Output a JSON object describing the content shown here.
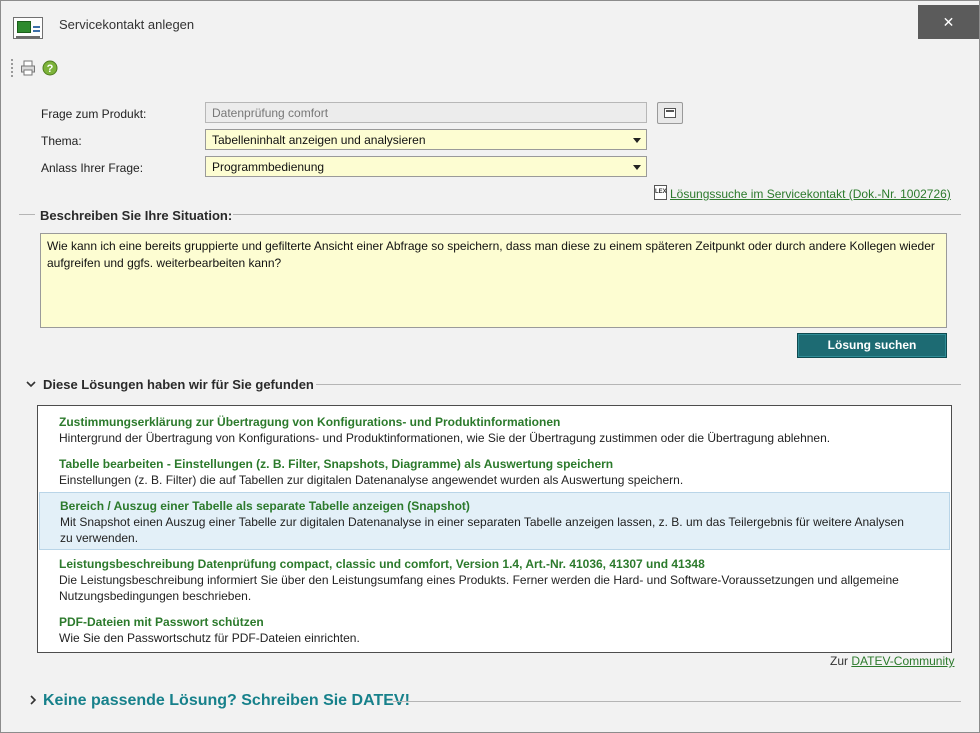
{
  "window": {
    "title": "Servicekontakt anlegen",
    "close_glyph": "✕"
  },
  "toolbar": {
    "icons": [
      "print-icon",
      "help-icon"
    ]
  },
  "form": {
    "product_label": "Frage zum Produkt:",
    "product_value": "Datenprüfung comfort",
    "topic_label": "Thema:",
    "topic_value": "Tabelleninhalt anzeigen und analysieren",
    "reason_label": "Anlass Ihrer Frage:",
    "reason_value": "Programmbedienung",
    "reference_link": "Lösungssuche im Servicekontakt (Dok.-Nr. 1002726)",
    "reference_icon_text": "LEX"
  },
  "situation": {
    "heading": "Beschreiben Sie Ihre Situation:",
    "text": "Wie kann ich eine bereits gruppierte und gefilterte Ansicht einer Abfrage so speichern, dass man diese zu einem späteren Zeitpunkt oder durch andere Kollegen wieder aufgreifen und ggfs. weiterbearbeiten kann?",
    "search_button": "Lösung suchen"
  },
  "solutions": {
    "heading": "Diese Lösungen haben wir für Sie gefunden",
    "items": [
      {
        "title": "Zustimmungserklärung zur Übertragung von Konfigurations- und Produktinformationen",
        "desc": "Hintergrund der Übertragung von Konfigurations- und Produktinformationen, wie Sie der Übertragung zustimmen oder die Übertragung ablehnen."
      },
      {
        "title": "Tabelle bearbeiten - Einstellungen (z. B. Filter, Snapshots, Diagramme) als Auswertung speichern",
        "desc": "Einstellungen (z. B. Filter) die auf Tabellen zur digitalen Datenanalyse angewendet wurden als Auswertung speichern."
      },
      {
        "title": "Bereich / Auszug einer Tabelle als separate Tabelle anzeigen (Snapshot)",
        "desc": "Mit Snapshot einen Auszug einer Tabelle zur digitalen Datenanalyse in einer separaten Tabelle anzeigen lassen, z. B. um das Teilergebnis für weitere Analysen zu verwenden."
      },
      {
        "title": "Leistungsbeschreibung Datenprüfung compact, classic und comfort, Version 1.4, Art.-Nr. 41036, 41307 und 41348",
        "desc": "Die Leistungsbeschreibung informiert Sie über den Leistungsumfang eines Produkts. Ferner werden die Hard- und Software-Voraussetzungen und allgemeine Nutzungsbedingungen beschrieben."
      },
      {
        "title": "PDF-Dateien mit Passwort schützen",
        "desc": "Wie Sie den Passwortschutz für PDF-Dateien einrichten."
      }
    ],
    "community_prefix": "Zur",
    "community_link": "DATEV-Community"
  },
  "contact": {
    "heading": "Keine passende Lösung? Schreiben Sie DATEV!"
  },
  "colors": {
    "accent_green": "#2c7a2c",
    "button_teal": "#1d6b73",
    "cta_teal": "#17818b",
    "input_yellow": "#fdfdd2",
    "selected_row": "#e3f0f8"
  }
}
